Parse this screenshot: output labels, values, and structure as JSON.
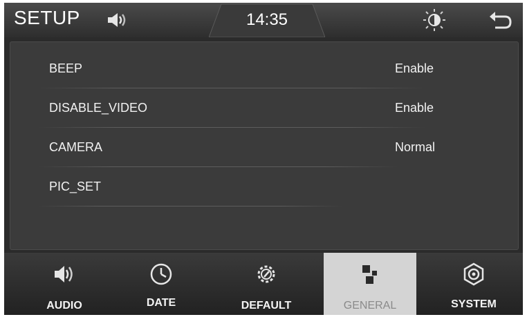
{
  "header": {
    "title": "SETUP",
    "time": "14:35"
  },
  "settings": [
    {
      "label": "BEEP",
      "value": "Enable"
    },
    {
      "label": "DISABLE_VIDEO",
      "value": "Enable"
    },
    {
      "label": "CAMERA",
      "value": "Normal"
    },
    {
      "label": "PIC_SET",
      "value": ""
    }
  ],
  "tabs": [
    {
      "label": "AUDIO",
      "icon": "speaker-icon"
    },
    {
      "label": "DATE",
      "icon": "clock-icon"
    },
    {
      "label": "DEFAULT",
      "icon": "reset-gear-icon"
    },
    {
      "label": "GENERAL",
      "icon": "general-squares-icon",
      "active": true
    },
    {
      "label": "SYSTEM",
      "icon": "system-gear-icon"
    }
  ],
  "colors": {
    "background": "#2b2b2b",
    "panel": "#3b3b3b",
    "active_tab": "#d4d4d4",
    "text": "#f2f2f2"
  }
}
